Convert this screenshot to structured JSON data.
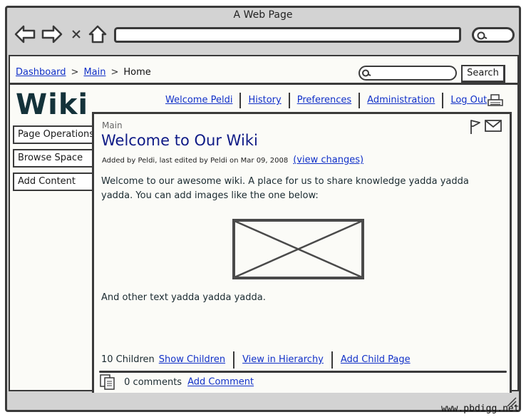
{
  "window": {
    "title": "A Web Page"
  },
  "breadcrumb": {
    "items": [
      "Dashboard",
      "Main"
    ],
    "current": "Home",
    "separator": ">"
  },
  "search": {
    "button_label": "Search",
    "placeholder": ""
  },
  "logo": {
    "text": "Wiki"
  },
  "topnav": {
    "items": [
      "Welcome Peldi",
      "History",
      "Preferences",
      "Administration",
      "Log Out"
    ]
  },
  "sidebar": {
    "items": [
      "Page Operations",
      "Browse Space",
      "Add Content"
    ]
  },
  "page": {
    "space": "Main",
    "title": "Welcome to Our Wiki",
    "meta": "Added by Peldi, last edited by Peldi on Mar 09, 2008",
    "view_changes": "(view changes)",
    "body_paragraph1": "Welcome to our awesome wiki. A place for us to share knowledge yadda yadda yadda. You can add images like the one below:",
    "body_paragraph2": "And other text yadda yadda yadda."
  },
  "children": {
    "count_label": "10 Children",
    "show_children": "Show Children",
    "view_hierarchy": "View in Hierarchy",
    "add_child": "Add Child Page"
  },
  "comments": {
    "count_label": "0 comments",
    "add_comment": "Add Comment"
  },
  "watermark": "www.pbdigg.net",
  "icons": {
    "back": "back-arrow-icon",
    "forward": "forward-arrow-icon",
    "stop": "close-icon",
    "home": "home-icon",
    "search": "search-icon",
    "print": "printer-icon",
    "flag": "flag-icon",
    "mail": "mail-icon",
    "comments": "comments-icon",
    "image": "image-placeholder-icon"
  },
  "colors": {
    "link": "#1030c8",
    "title": "#0e1a86",
    "chrome": "#d3d3d3",
    "logo": "#14323a"
  }
}
